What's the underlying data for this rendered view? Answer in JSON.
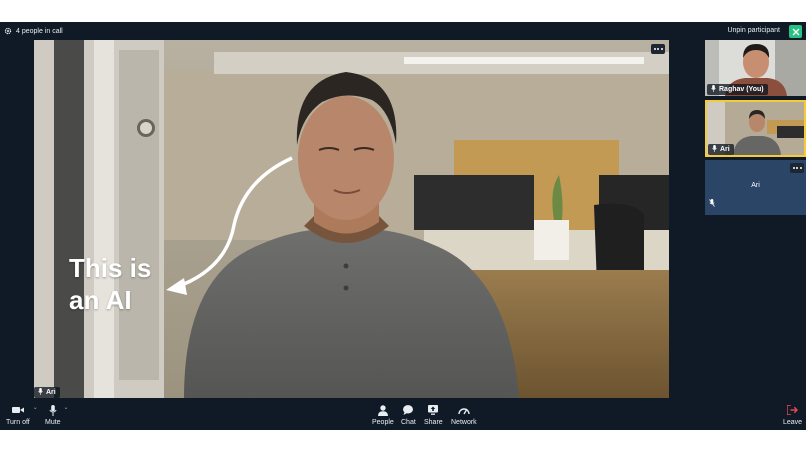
{
  "topbar": {
    "participants_label": "4 people in call",
    "unpin_label": "Unpin participant"
  },
  "main_video": {
    "participant_name": "Ari",
    "caption": "This is\nan AI"
  },
  "side_tiles": [
    {
      "name": "Raghav (You)"
    },
    {
      "name": "Ari",
      "pinned": true
    },
    {
      "name": "Ari",
      "video_off": true
    }
  ],
  "controls": {
    "camera": "Turn off",
    "mute": "Mute",
    "people": "People",
    "chat": "Chat",
    "share": "Share",
    "network": "Network",
    "leave": "Leave"
  },
  "colors": {
    "background": "#101a26",
    "accent_green": "#27c281",
    "active_speaker_border": "#f3cb3b",
    "leave_red": "#e5484d",
    "video_off_tile": "#2a4566"
  },
  "icons": [
    "gear-icon",
    "close-icon",
    "more-icon",
    "microphone-icon",
    "microphone-muted-icon",
    "camera-icon",
    "people-icon",
    "chat-icon",
    "share-icon",
    "network-icon",
    "leave-icon",
    "arrow-icon"
  ]
}
